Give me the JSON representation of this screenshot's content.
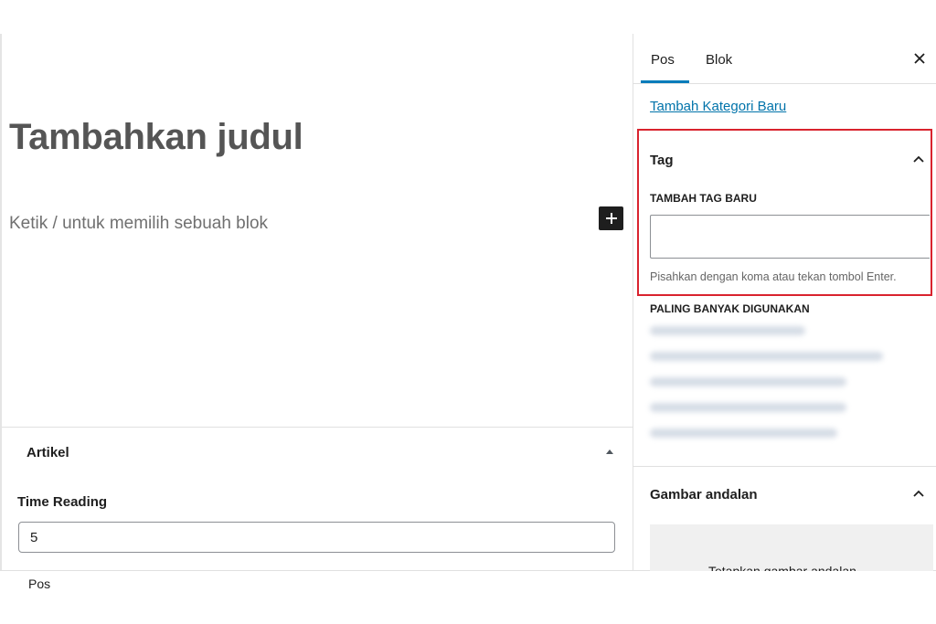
{
  "editor": {
    "title_placeholder": "Tambahkan judul",
    "block_placeholder": "Ketik / untuk memilih sebuah blok"
  },
  "metabox": {
    "title": "Artikel",
    "time_reading_label": "Time Reading",
    "time_reading_value": "5"
  },
  "footer": {
    "breadcrumb": "Pos"
  },
  "sidebar": {
    "tabs": [
      {
        "label": "Pos",
        "active": true
      },
      {
        "label": "Blok",
        "active": false
      }
    ],
    "add_category_link": "Tambah Kategori Baru",
    "tag_panel": {
      "title": "Tag",
      "add_label": "TAMBAH TAG BARU",
      "input_value": "",
      "help": "Pisahkan dengan koma atau tekan tombol Enter.",
      "most_used_label": "PALING BANYAK DIGUNAKAN"
    },
    "featured_image": {
      "title": "Gambar andalan",
      "dropzone_text": "Tetapkan gambar andalan"
    }
  },
  "colors": {
    "accent": "#007cba",
    "link": "#0073aa",
    "highlight": "#d9232e",
    "title_text": "#555555"
  },
  "icons": {
    "inserter": "plus-icon",
    "close": "close-icon",
    "panel_toggle": "chevron-up-icon",
    "metabox_toggle": "triangle-up-icon"
  }
}
